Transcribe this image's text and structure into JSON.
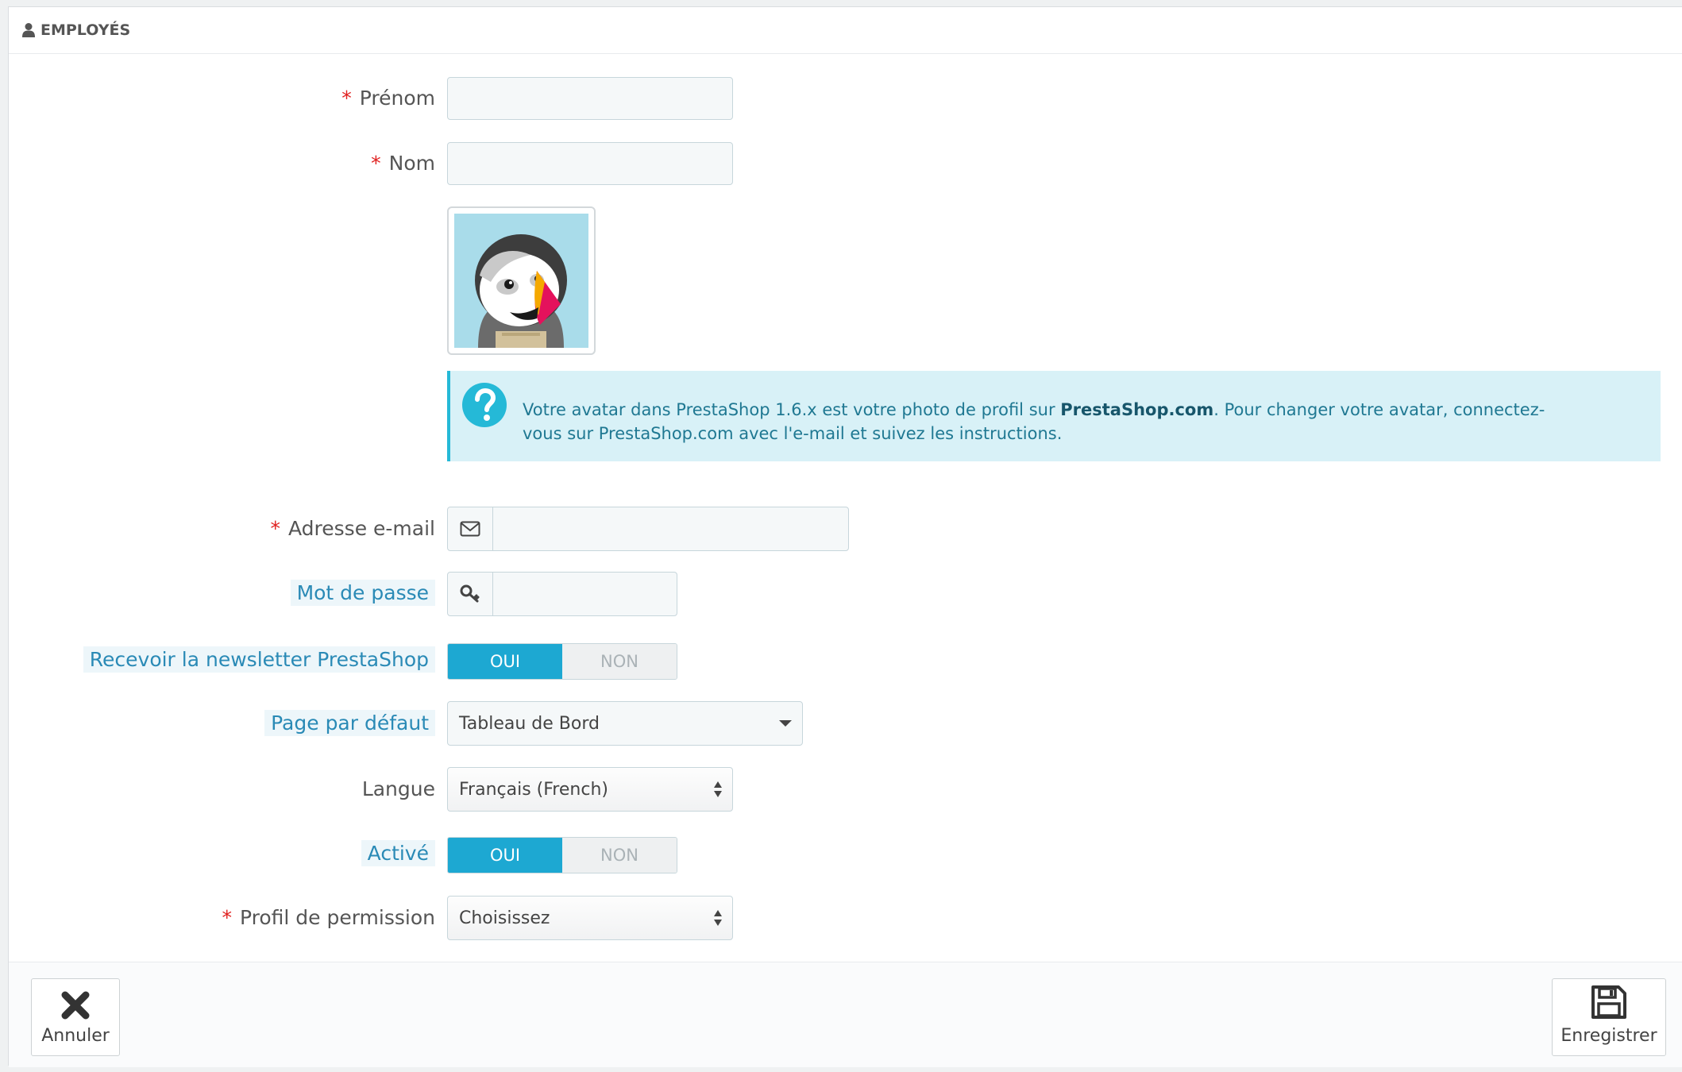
{
  "panel": {
    "title": "EMPLOYÉS",
    "title_icon": "user-icon"
  },
  "fields": {
    "firstname": {
      "label": "Prénom",
      "required": "*",
      "value": ""
    },
    "lastname": {
      "label": "Nom",
      "required": "*",
      "value": ""
    },
    "email": {
      "label": "Adresse e-mail",
      "required": "*",
      "value": "",
      "icon": "envelope-icon"
    },
    "password": {
      "label": "Mot de passe",
      "value": "",
      "icon": "key-icon"
    },
    "newsletter": {
      "label": "Recevoir la newsletter PrestaShop",
      "yes": "OUI",
      "no": "NON",
      "selected": "OUI"
    },
    "default_page": {
      "label": "Page par défaut",
      "value": "Tableau de Bord"
    },
    "language": {
      "label": "Langue",
      "value": "Français (French)"
    },
    "active": {
      "label": "Activé",
      "yes": "OUI",
      "no": "NON",
      "selected": "OUI"
    },
    "profile": {
      "label": "Profil de permission",
      "required": "*",
      "value": "Choisissez"
    }
  },
  "avatar": {
    "alt_icon": "prestashop-puffin-avatar"
  },
  "alert": {
    "icon": "question-circle-icon",
    "text_before": "Votre avatar dans PrestaShop 1.6.x est votre photo de profil sur ",
    "text_bold": "PrestaShop.com",
    "text_after": ". Pour changer votre avatar, connectez-vous sur PrestaShop.com avec l'e-mail et suivez les instructions."
  },
  "footer": {
    "cancel_label": "Annuler",
    "cancel_icon": "close-icon",
    "save_label": "Enregistrer",
    "save_icon": "floppy-disk-icon"
  },
  "colors": {
    "accent": "#1da8d2",
    "alert_bg": "#d8f1f7",
    "required": "#e0201f",
    "hint_label": "#2a8ab6"
  }
}
